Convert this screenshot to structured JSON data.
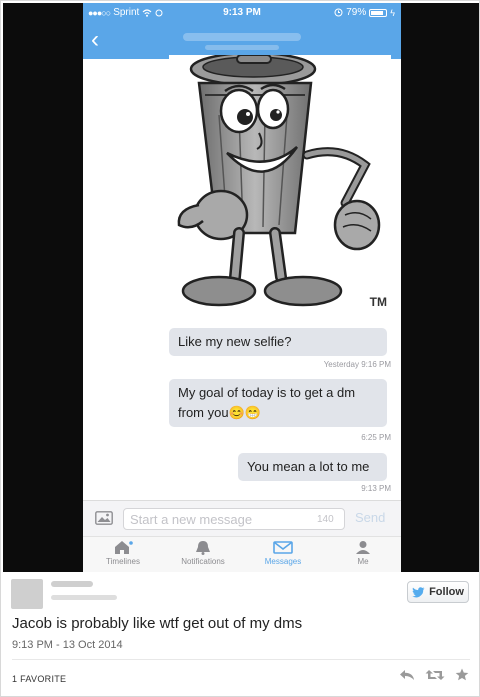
{
  "status_bar": {
    "carrier": "Sprint",
    "signal_dots": "●●●○○",
    "time": "9:13 PM",
    "battery": "79%"
  },
  "nav": {
    "back_glyph": "‹"
  },
  "image": {
    "trademark": "TM"
  },
  "messages": [
    {
      "text": "Like my new selfie?",
      "timestamp": "Yesterday 9:16 PM"
    },
    {
      "text": "My goal of today is to get a dm from you😊😁",
      "timestamp": "6:25 PM"
    },
    {
      "text": "You mean a lot to me",
      "timestamp": "9:13 PM"
    }
  ],
  "composer": {
    "placeholder": "Start a new message",
    "char_count": "140",
    "send_label": "Send"
  },
  "tabs": [
    {
      "label": "Timelines",
      "icon": "home-icon",
      "active": false
    },
    {
      "label": "Notifications",
      "icon": "bell-icon",
      "active": false
    },
    {
      "label": "Messages",
      "icon": "envelope-icon",
      "active": true
    },
    {
      "label": "Me",
      "icon": "person-icon",
      "active": false
    }
  ],
  "tweet": {
    "follow_label": "Follow",
    "text": "Jacob is probably like wtf get out of my dms",
    "meta": "9:13 PM - 13 Oct 2014",
    "favorites": "1 FAVORITE"
  },
  "colors": {
    "twitter_blue": "#5aa6e8",
    "bubble_gray": "#e1e4ea",
    "photo_background": "#0c0c0c"
  }
}
